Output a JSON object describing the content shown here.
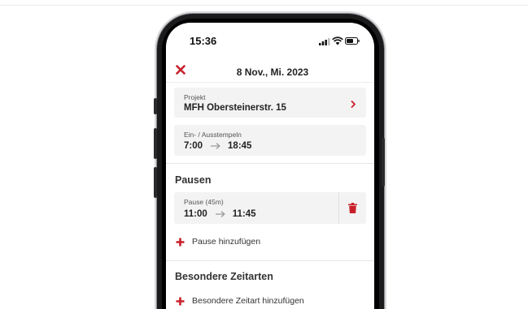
{
  "status_bar": {
    "time": "15:36"
  },
  "header": {
    "title": "8 Nov., Mi. 2023"
  },
  "project": {
    "label": "Projekt",
    "value": "MFH Obersteinerstr. 15"
  },
  "clock": {
    "label": "Ein- / Ausstempeln",
    "start": "7:00",
    "end": "18:45"
  },
  "breaks": {
    "title": "Pausen",
    "items": [
      {
        "label": "Pause (45m)",
        "start": "11:00",
        "end": "11:45"
      }
    ],
    "add_label": "Pause hinzufügen"
  },
  "special": {
    "title": "Besondere Zeitarten",
    "add_label": "Besondere Zeitart hinzufügen"
  },
  "colors": {
    "accent": "#c8202a",
    "card_bg": "#f4f3f3",
    "arrow": "#9a9a9a"
  },
  "icons": [
    "close-icon",
    "chevron-right-icon",
    "arrow-right-icon",
    "trash-icon",
    "plus-icon",
    "signal-icon",
    "wifi-icon",
    "battery-icon"
  ]
}
